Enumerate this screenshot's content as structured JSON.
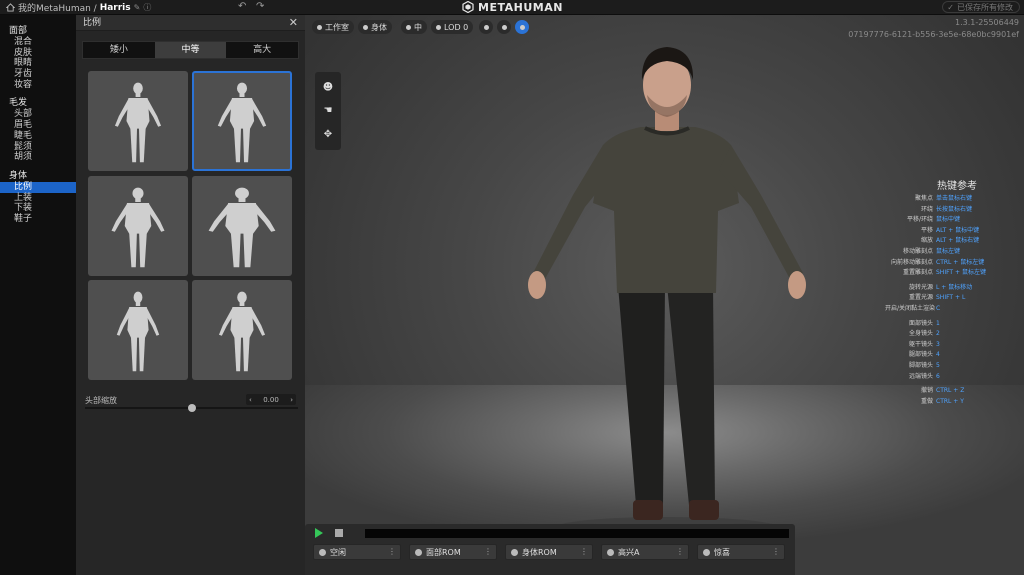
{
  "topbar": {
    "breadcrumb_root": "我的MetaHuman /",
    "character_name": "Harris",
    "brand": "METAHUMAN",
    "saved_label": "已保存所有修改"
  },
  "nav": {
    "groups": [
      {
        "title": "面部",
        "items": [
          "混合",
          "皮肤",
          "眼睛",
          "牙齿",
          "妆容"
        ]
      },
      {
        "title": "毛发",
        "items": [
          "头部",
          "眉毛",
          "睫毛",
          "髭须",
          "胡须"
        ]
      },
      {
        "title": "身体",
        "items": [
          "比例",
          "上装",
          "下装",
          "鞋子"
        ],
        "active": "比例"
      }
    ]
  },
  "panel": {
    "title": "比例",
    "segments": [
      "矮小",
      "中等",
      "高大"
    ],
    "selected_segment": "中等",
    "selected_tile": 2,
    "tile_count": 6,
    "head_scale_label": "头部缩放",
    "head_scale_value": "0.00",
    "head_scale_fraction": 0.5
  },
  "viewport": {
    "toolbar": [
      "工作室",
      "身体",
      "中",
      "LOD 0"
    ],
    "version": "1.3.1-25506449",
    "guid": "07197776-6121-b556-3e5e-68e0bc9901ef",
    "hotkeys_title": "热键参考",
    "hotkeys": [
      {
        "k": "聚焦点",
        "v": "单击鼠标右键"
      },
      {
        "k": "环绕",
        "v": "长按鼠标右键"
      },
      {
        "k": "平移/环绕",
        "v": "鼠标中键"
      },
      {
        "k": "平移",
        "v": "ALT + 鼠标中键"
      },
      {
        "k": "缩放",
        "v": "ALT + 鼠标右键"
      },
      {
        "k": "移动雕刻点",
        "v": "鼠标左键"
      },
      {
        "k": "向前移动雕刻点",
        "v": "CTRL + 鼠标左键"
      },
      {
        "k": "重置雕刻点",
        "v": "SHIFT + 鼠标左键"
      },
      {
        "gap": true
      },
      {
        "k": "旋转光源",
        "v": "L + 鼠标移动"
      },
      {
        "k": "重置光源",
        "v": "SHIFT + L"
      },
      {
        "k": "开启/关闭黏土渲染",
        "v": "C"
      },
      {
        "gap": true
      },
      {
        "k": "面部镜头",
        "v": "1"
      },
      {
        "k": "全身镜头",
        "v": "2"
      },
      {
        "k": "躯干镜头",
        "v": "3"
      },
      {
        "k": "腿部镜头",
        "v": "4"
      },
      {
        "k": "脚部镜头",
        "v": "5"
      },
      {
        "k": "远端镜头",
        "v": "6"
      },
      {
        "gap": true
      },
      {
        "k": "撤销",
        "v": "CTRL + Z"
      },
      {
        "k": "重做",
        "v": "CTRL + Y"
      }
    ],
    "animations": [
      "空闲",
      "面部ROM",
      "身体ROM",
      "高兴A",
      "惊喜"
    ]
  }
}
